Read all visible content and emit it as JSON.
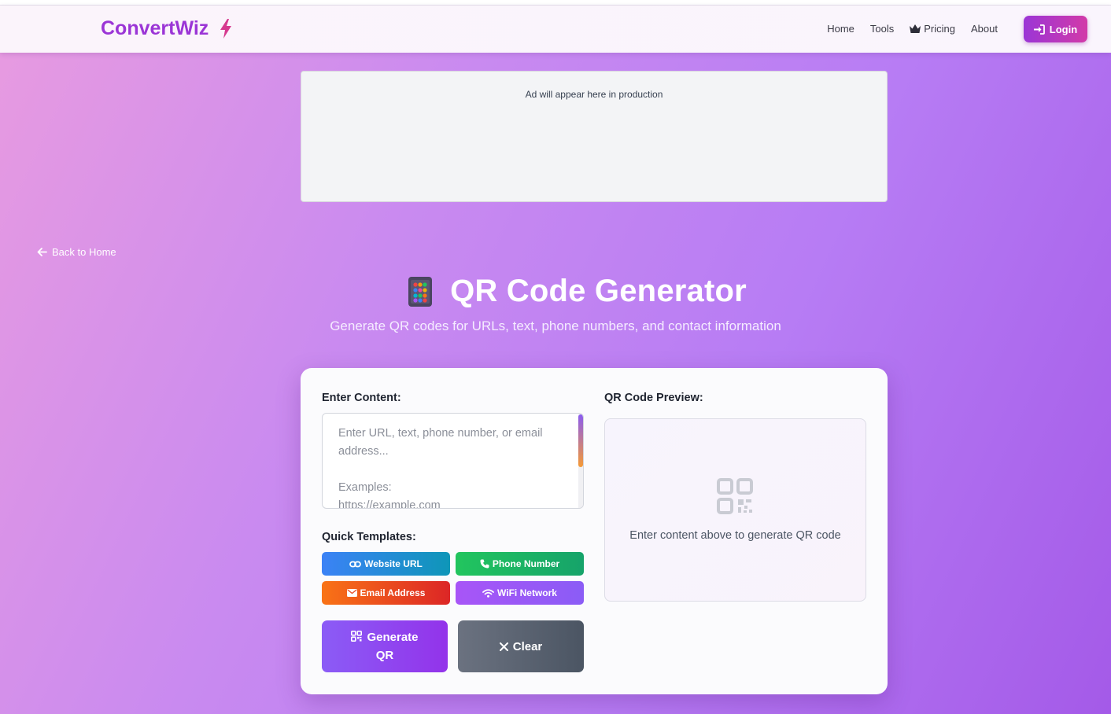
{
  "brand": {
    "name": "ConvertWiz",
    "icon": "lightning-icon",
    "color": "#9b35d6"
  },
  "nav": {
    "items": [
      {
        "label": "Home"
      },
      {
        "label": "Tools"
      },
      {
        "label": "Pricing",
        "icon": "crown-icon"
      },
      {
        "label": "About"
      }
    ],
    "login_label": "Login"
  },
  "ad": {
    "text": "Ad will appear here in production"
  },
  "back_link": "Back to Home",
  "hero": {
    "title": "QR Code Generator",
    "subtitle": "Generate QR codes for URLs, text, phone numbers, and contact information",
    "icon": "abacus-icon"
  },
  "form": {
    "content_label": "Enter Content:",
    "placeholder": "Enter URL, text, phone number, or email address...\n\nExamples:\nhttps://example.com",
    "templates_label": "Quick Templates:",
    "templates": [
      {
        "label": "Website URL",
        "icon": "link-icon"
      },
      {
        "label": "Phone Number",
        "icon": "phone-icon"
      },
      {
        "label": "Email Address",
        "icon": "envelope-icon"
      },
      {
        "label": "WiFi Network",
        "icon": "wifi-icon"
      }
    ],
    "generate_label": "Generate QR",
    "clear_label": "Clear"
  },
  "preview": {
    "label": "QR Code Preview:",
    "empty_text": "Enter content above to generate QR code"
  }
}
